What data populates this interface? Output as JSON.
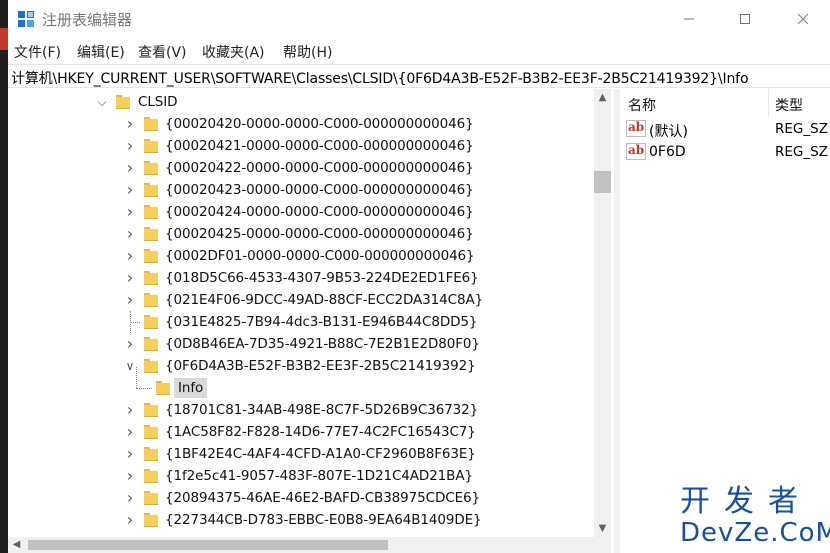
{
  "window": {
    "title": "注册表编辑器"
  },
  "menu": [
    "文件(F)",
    "编辑(E)",
    "查看(V)",
    "收藏夹(A)",
    "帮助(H)"
  ],
  "address": "计算机\\HKEY_CURRENT_USER\\SOFTWARE\\Classes\\CLSID\\{0F6D4A3B-E52F-B3B2-EE3F-2B5C21419392}\\Info",
  "tree": {
    "root": "CLSID",
    "keys": [
      "{00020420-0000-0000-C000-000000000046}",
      "{00020421-0000-0000-C000-000000000046}",
      "{00020422-0000-0000-C000-000000000046}",
      "{00020423-0000-0000-C000-000000000046}",
      "{00020424-0000-0000-C000-000000000046}",
      "{00020425-0000-0000-C000-000000000046}",
      "{0002DF01-0000-0000-C000-000000000046}",
      "{018D5C66-4533-4307-9B53-224DE2ED1FE6}",
      "{021E4F06-9DCC-49AD-88CF-ECC2DA314C8A}",
      "{031E4825-7B94-4dc3-B131-E946B44C8DD5}",
      "{0D8B46EA-7D35-4921-B88C-7E2B1E2D80F0}",
      "{0F6D4A3B-E52F-B3B2-EE3F-2B5C21419392}"
    ],
    "selected_child": "Info",
    "keys_after": [
      "{18701C81-34AB-498E-8C7F-5D26B9C36732}",
      "{1AC58F82-F828-14D6-77E7-4C2FC16543C7}",
      "{1BF42E4C-4AF4-4CFD-A1A0-CF2960B8F63E}",
      "{1f2e5c41-9057-483F-807E-1D21C4AD21BA}",
      "{20894375-46AE-46E2-BAFD-CB38975CDCE6}",
      "{227344CB-D783-EBBC-E0B8-9EA64B1409DE}"
    ]
  },
  "values_pane": {
    "col_name": "名称",
    "col_type": "类型",
    "rows": [
      {
        "name": "(默认)",
        "type": "REG_SZ"
      },
      {
        "name": "0F6D",
        "type": "REG_SZ"
      }
    ]
  },
  "watermark": {
    "cn": "开发者",
    "en": "DevZe.CoM"
  }
}
